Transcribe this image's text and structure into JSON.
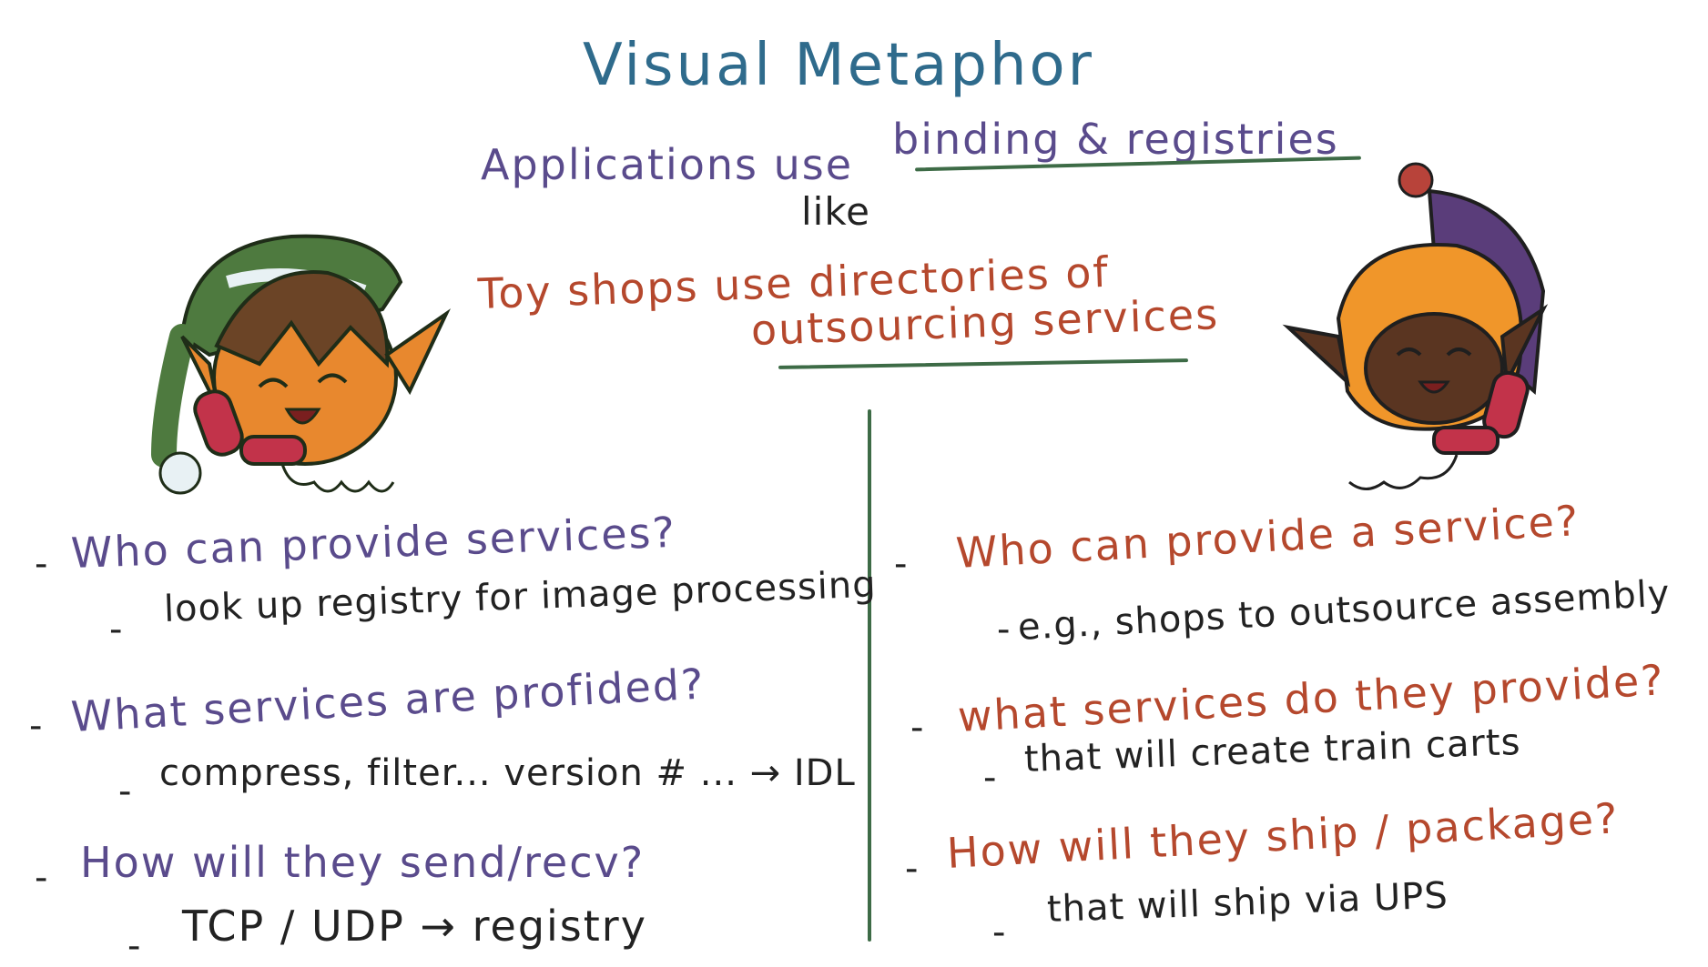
{
  "title": "Visual Metaphor",
  "top": {
    "line1_prefix": "Applications use",
    "line1_underlined": "binding & registries",
    "like": "like",
    "line2": "Toy shops use directories of",
    "line3": "outsourcing services"
  },
  "left": {
    "items": [
      {
        "dash": "-",
        "question": "Who can provide services?",
        "sub_dash": "-",
        "answer": "look up registry for image processing"
      },
      {
        "dash": "-",
        "question": "What services are profided?",
        "sub_dash": "-",
        "answer": "compress, filter... version # ... → IDL"
      },
      {
        "dash": "-",
        "question": "How will they send/recv?",
        "sub_dash": "-",
        "answer": "TCP / UDP → registry"
      }
    ]
  },
  "right": {
    "items": [
      {
        "dash": "-",
        "question": "Who can provide a service?",
        "sub_dash": "-",
        "answer": "e.g., shops to outsource assembly"
      },
      {
        "dash": "-",
        "question": "what services do they provide?",
        "sub_dash": "-",
        "answer": "that will create train carts"
      },
      {
        "dash": "-",
        "question": "How will they ship / package?",
        "sub_dash": "-",
        "answer": "that will ship via UPS"
      }
    ]
  },
  "colors": {
    "title": "#2f6b8c",
    "purple": "#5a4b8c",
    "red": "#b5482d",
    "green_line": "#3d6b46",
    "ink": "#222222"
  },
  "icons": [
    "elf-green-hat-on-phone",
    "elf-purple-hat-on-phone"
  ]
}
